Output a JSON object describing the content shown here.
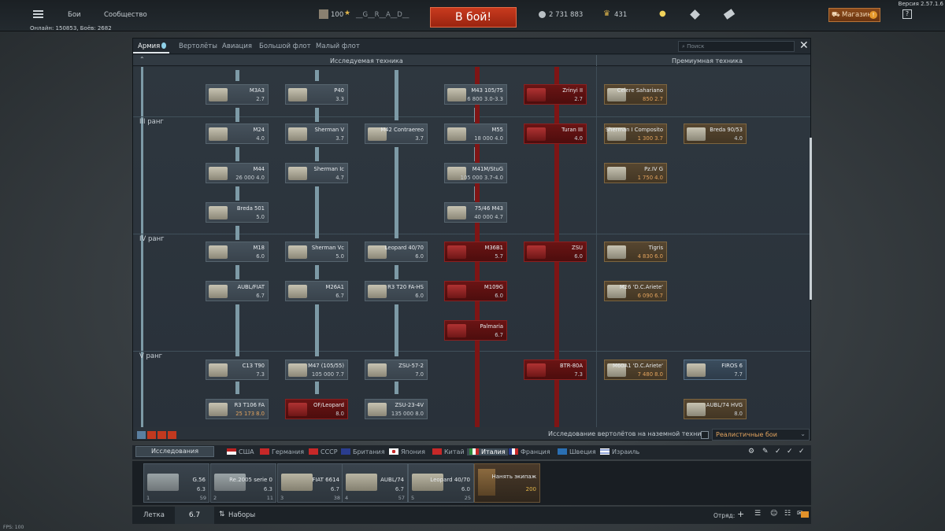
{
  "topbar": {
    "battles": "Бои",
    "community": "Сообщество",
    "level": "100",
    "player": "__G__R__A__D__",
    "battle_button": "В бой!",
    "silver": "2 731 883",
    "golden_eagles": "431",
    "shop": "Магазин",
    "help": "?",
    "version": "Версия 2.57.1.6",
    "online": "Онлайн: 150853, Боёв: 2682"
  },
  "tabs": [
    "Армия",
    "Вертолёты",
    "Авиация",
    "Большой флот",
    "Малый флот"
  ],
  "search_placeholder": "Поиск",
  "columns": {
    "research": "Исследуемая техника",
    "premium": "Премиумная техника"
  },
  "ranks": [
    "III ранг",
    "IV ранг",
    "V ранг"
  ],
  "vehicles": {
    "m3a3": {
      "name": "M3A3",
      "sub": "2.7"
    },
    "p40": {
      "name": "P40",
      "sub": "3.3"
    },
    "m43": {
      "name": "M43 105/75",
      "sub": "6 800 3.0-3.3"
    },
    "zrinyi": {
      "name": "Zrinyi II",
      "sub": "2.7"
    },
    "celere": {
      "name": "Celere Sahariano",
      "sub": "850 2.7"
    },
    "m24": {
      "name": "M24",
      "sub": "4.0"
    },
    "shermanv": {
      "name": "Sherman V",
      "sub": "3.7"
    },
    "m42": {
      "name": "M42 Contraereo",
      "sub": "3.7"
    },
    "m55": {
      "name": "M55",
      "sub": "18 000 4.0"
    },
    "turan": {
      "name": "Turan III",
      "sub": "4.0"
    },
    "shermanic_comp": {
      "name": "Sherman I Composito",
      "sub": "1 300 3.7"
    },
    "breda90": {
      "name": "Breda 90/53",
      "sub": "4.0"
    },
    "m44": {
      "name": "M44",
      "sub": "26 000 4.0"
    },
    "shermanic": {
      "name": "Sherman Ic",
      "sub": "4.7"
    },
    "m41m": {
      "name": "M41M/StuG",
      "sub": "105 000 3.7-4.0"
    },
    "pz4g": {
      "name": "Pz.IV G",
      "sub": "1 750 4.0"
    },
    "breda501": {
      "name": "Breda 501",
      "sub": "5.0"
    },
    "m7546": {
      "name": "75/46 M43",
      "sub": "40 000 4.7"
    },
    "m18": {
      "name": "M18",
      "sub": "6.0"
    },
    "shermanvc": {
      "name": "Sherman Vc",
      "sub": "5.0"
    },
    "leopard4070": {
      "name": "Leopard 40/70",
      "sub": "6.0"
    },
    "m36b1": {
      "name": "M36B1",
      "sub": "5.7"
    },
    "zsu": {
      "name": "ZSU",
      "sub": "6.0"
    },
    "tigris": {
      "name": "Tigris",
      "sub": "4 830 6.0"
    },
    "aubl_fiat": {
      "name": "AUBL/FIAT",
      "sub": "6.7"
    },
    "m26a1": {
      "name": "M26A1",
      "sub": "6.7"
    },
    "r3t20": {
      "name": "R3 T20 FA-HS",
      "sub": "6.0"
    },
    "m109g": {
      "name": "M109G",
      "sub": "6.0"
    },
    "m26ariete": {
      "name": "M26 'D.C.Ariete'",
      "sub": "6 090 6.7"
    },
    "palmaria": {
      "name": "Palmaria",
      "sub": "6.7"
    },
    "c13t90": {
      "name": "C13 T90",
      "sub": "7.3"
    },
    "m47": {
      "name": "M47 (105/55)",
      "sub": "105 000 7.7"
    },
    "zsu572": {
      "name": "ZSU-57-2",
      "sub": "7.0"
    },
    "btr80a": {
      "name": "BTR-80A",
      "sub": "7.3"
    },
    "m60a1": {
      "name": "M60A1 'D.C.Ariete'",
      "sub": "7 480 8.0"
    },
    "firos": {
      "name": "FIROS 6",
      "sub": "7.7"
    },
    "r3t106": {
      "name": "R3 T106 FA",
      "sub": "25 173 8.0"
    },
    "of40": {
      "name": "OF/Leopard",
      "sub": "8.0"
    },
    "zsu234": {
      "name": "ZSU-23-4V",
      "sub": "135 000 8.0"
    },
    "aubl74": {
      "name": "AUBL/74 HVG",
      "sub": "8.0"
    }
  },
  "bottom": {
    "helicopter_research": "Исследование вертолётов на наземной технике",
    "mode": "Реалистичные бои",
    "research_dropdown": "Исследования"
  },
  "nations": [
    "США",
    "Германия",
    "СССР",
    "Британия",
    "Япония",
    "Китай",
    "Италия",
    "Франция",
    "Швеция",
    "Израиль"
  ],
  "crew": [
    {
      "name": "G.56",
      "br": "6.3",
      "slot": "1",
      "count": "59"
    },
    {
      "name": "Re.2005 serie 0",
      "br": "6.3",
      "slot": "2",
      "count": "11"
    },
    {
      "name": "FIAT 6614",
      "br": "6.7",
      "slot": "3",
      "count": "38"
    },
    {
      "name": "AUBL/74",
      "br": "6.7",
      "slot": "4",
      "count": "57"
    },
    {
      "name": "Leopard 40/70",
      "br": "6.0",
      "slot": "5",
      "count": "25"
    }
  ],
  "crew_buy": {
    "label": "Нанять экипаж",
    "cost": "200"
  },
  "footer": {
    "tab_fleet": "Летка",
    "br": "6.7",
    "presets": "Наборы",
    "squad": "Отряд:"
  },
  "fps": "FPS: 100"
}
